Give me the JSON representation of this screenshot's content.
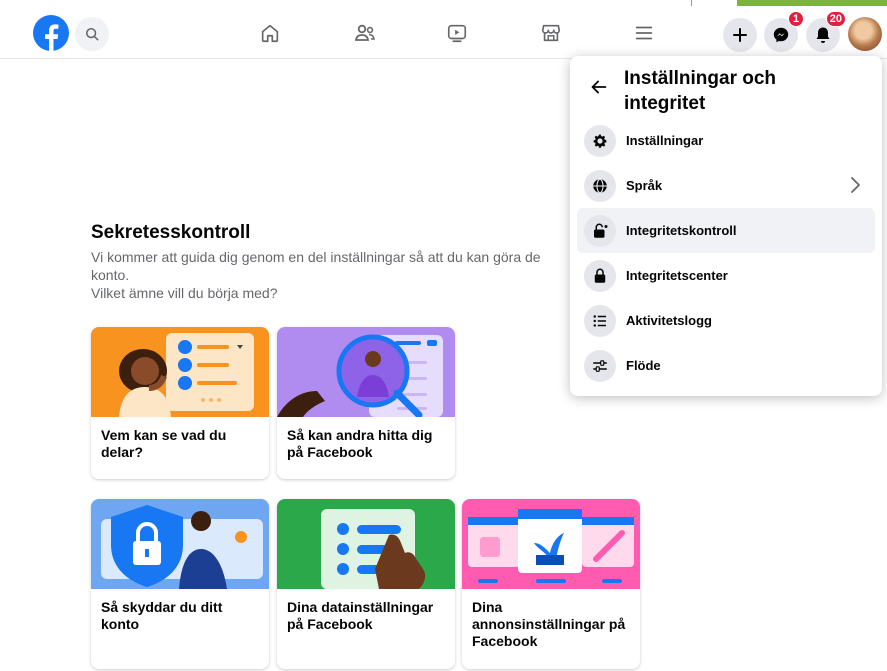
{
  "nav": {
    "badges": {
      "messenger": "1",
      "notifications": "20"
    }
  },
  "main": {
    "title": "Sekretesskontroll",
    "intro_line1": "Vi kommer att guida dig genom en del inställningar så att du kan göra de",
    "intro_line2": "konto.",
    "question": "Vilket ämne vill du börja med?"
  },
  "cards": [
    {
      "label": "Vem kan se vad du delar?"
    },
    {
      "label": "Så kan andra hitta dig på Facebook"
    },
    {
      "label": "Så skyddar du ditt konto"
    },
    {
      "label": "Dina datainställningar på Facebook"
    },
    {
      "label": "Dina annonsinställningar på Facebook"
    }
  ],
  "menu": {
    "title": "Inställningar och integritet",
    "items": [
      {
        "label": "Inställningar",
        "icon": "gear-icon"
      },
      {
        "label": "Språk",
        "icon": "globe-icon"
      },
      {
        "label": "Integritetskontroll",
        "icon": "lock-check-icon"
      },
      {
        "label": "Integritetscenter",
        "icon": "lock-icon"
      },
      {
        "label": "Aktivitetslogg",
        "icon": "list-icon"
      },
      {
        "label": "Flöde",
        "icon": "sliders-icon"
      }
    ]
  },
  "colors": {
    "brand": "#1877f2",
    "badge": "#e41e3f"
  }
}
